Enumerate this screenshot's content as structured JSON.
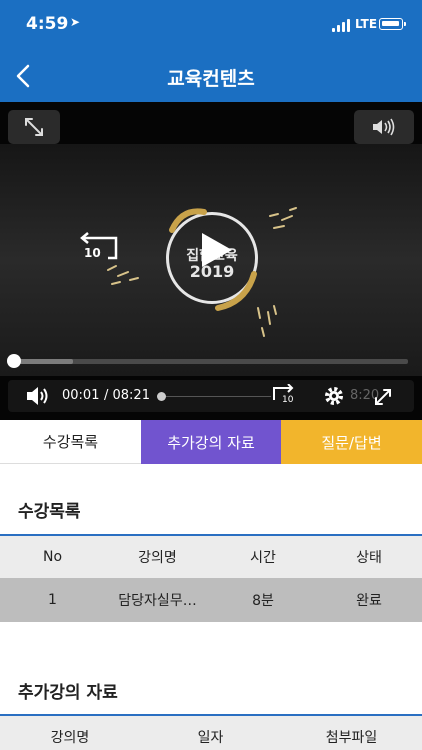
{
  "status_bar": {
    "time": "4:59",
    "carrier": "LTE"
  },
  "header": {
    "title": "교육컨텐츠"
  },
  "player": {
    "logo_line1": "집합교육",
    "logo_line2": "2019",
    "replay_label": "10",
    "skip_label": "10",
    "current_time": "00:01",
    "duration": "/  08:21",
    "ghost_time": "8:20",
    "progress_fraction": 0.15
  },
  "tabs": [
    {
      "label": "수강목록",
      "active": false
    },
    {
      "label": "추가강의 자료",
      "active": true
    },
    {
      "label": "질문/답변",
      "active": false
    }
  ],
  "course_list": {
    "title": "수강목록",
    "columns": [
      "No",
      "강의명",
      "시간",
      "상태"
    ],
    "rows": [
      {
        "no": "1",
        "name": "담당자실무…",
        "time": "8분",
        "status": "완료"
      }
    ]
  },
  "extra_materials": {
    "title": "추가강의 자료",
    "columns": [
      "강의명",
      "일자",
      "첨부파일"
    ]
  },
  "colors": {
    "brand_blue": "#1b6fc2",
    "tab_purple": "#7154cf",
    "tab_yellow": "#f2b52c"
  }
}
